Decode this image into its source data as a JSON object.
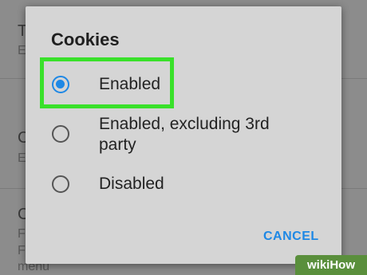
{
  "background": {
    "rows": [
      {
        "title": "T",
        "sub": "E"
      },
      {
        "title": "C",
        "sub": "E"
      },
      {
        "title": "C",
        "sub": "F"
      }
    ],
    "extra_sub": [
      "F",
      "menu"
    ]
  },
  "dialog": {
    "title": "Cookies",
    "options": [
      {
        "label": "Enabled",
        "selected": true
      },
      {
        "label": "Enabled, excluding 3rd party",
        "selected": false
      },
      {
        "label": "Disabled",
        "selected": false
      }
    ],
    "cancel_label": "CANCEL"
  },
  "colors": {
    "accent": "#1e88e5",
    "highlight": "#39e12a",
    "dialog_bg": "#d5d5d5"
  },
  "watermark": "wikiHow"
}
